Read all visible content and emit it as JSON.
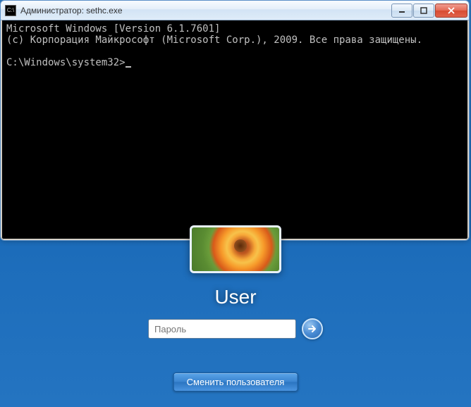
{
  "window": {
    "title": "Администратор: sethc.exe",
    "icon_label": "C:\\"
  },
  "console": {
    "line1": "Microsoft Windows [Version 6.1.7601]",
    "line2": "(c) Корпорация Майкрософт (Microsoft Corp.), 2009. Все права защищены.",
    "prompt": "C:\\Windows\\system32>"
  },
  "login": {
    "username": "User",
    "password_placeholder": "Пароль",
    "switch_user_label": "Сменить пользователя"
  }
}
